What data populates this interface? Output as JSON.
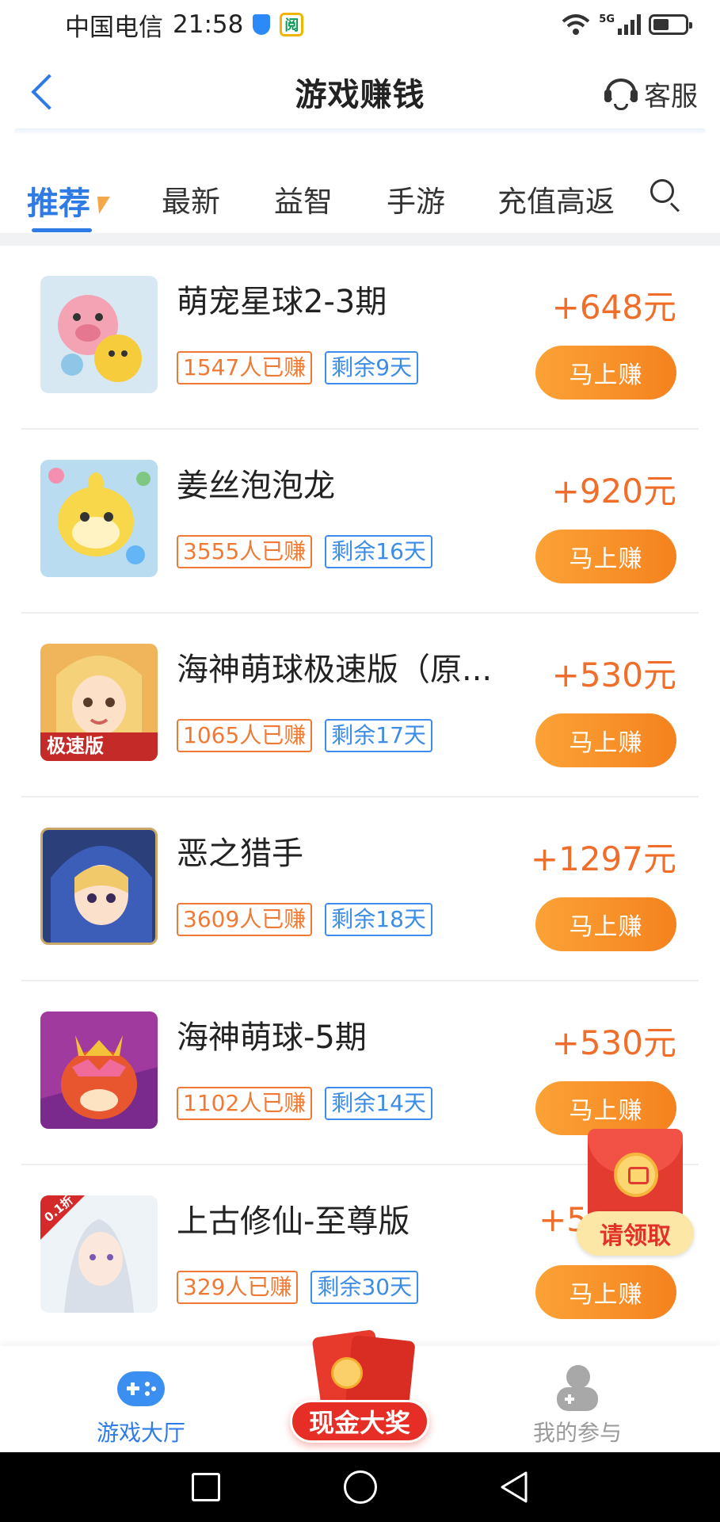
{
  "status_bar": {
    "carrier": "中国电信",
    "time": "21:58",
    "network": "5G"
  },
  "header": {
    "title": "游戏赚钱",
    "service_label": "客服"
  },
  "tabs": [
    {
      "label": "推荐",
      "active": true
    },
    {
      "label": "最新",
      "active": false
    },
    {
      "label": "益智",
      "active": false
    },
    {
      "label": "手游",
      "active": false
    },
    {
      "label": "充值高返",
      "active": false
    }
  ],
  "games": [
    {
      "name": "萌宠星球2-3期",
      "earned": "1547人已赚",
      "remaining": "剩余9天",
      "reward": "+648元",
      "button": "马上赚"
    },
    {
      "name": "姜丝泡泡龙",
      "earned": "3555人已赚",
      "remaining": "剩余16天",
      "reward": "+920元",
      "button": "马上赚"
    },
    {
      "name": "海神萌球极速版（原...",
      "earned": "1065人已赚",
      "remaining": "剩余17天",
      "reward": "+530元",
      "button": "马上赚"
    },
    {
      "name": "恶之猎手",
      "earned": "3609人已赚",
      "remaining": "剩余18天",
      "reward": "+1297元",
      "button": "马上赚"
    },
    {
      "name": "海神萌球-5期",
      "earned": "1102人已赚",
      "remaining": "剩余14天",
      "reward": "+530元",
      "button": "马上赚"
    },
    {
      "name": "上古修仙-至尊版",
      "earned": "329人已赚",
      "remaining": "剩余30天",
      "reward": "+5",
      "button": "马上赚"
    }
  ],
  "game_icon_badges": {
    "speed": "极速版",
    "discount": "0.1折"
  },
  "float_packet": {
    "label": "请领取"
  },
  "bottom_nav": {
    "hall": "游戏大厅",
    "cash": "现金大奖",
    "mine": "我的参与"
  },
  "colors": {
    "accent_blue": "#2f7be6",
    "reward_orange": "#f06e2a",
    "button_orange": "#f7901f",
    "tag_orange": "#f07a34",
    "tag_blue": "#3b8de8",
    "red_packet": "#e33b2f"
  }
}
